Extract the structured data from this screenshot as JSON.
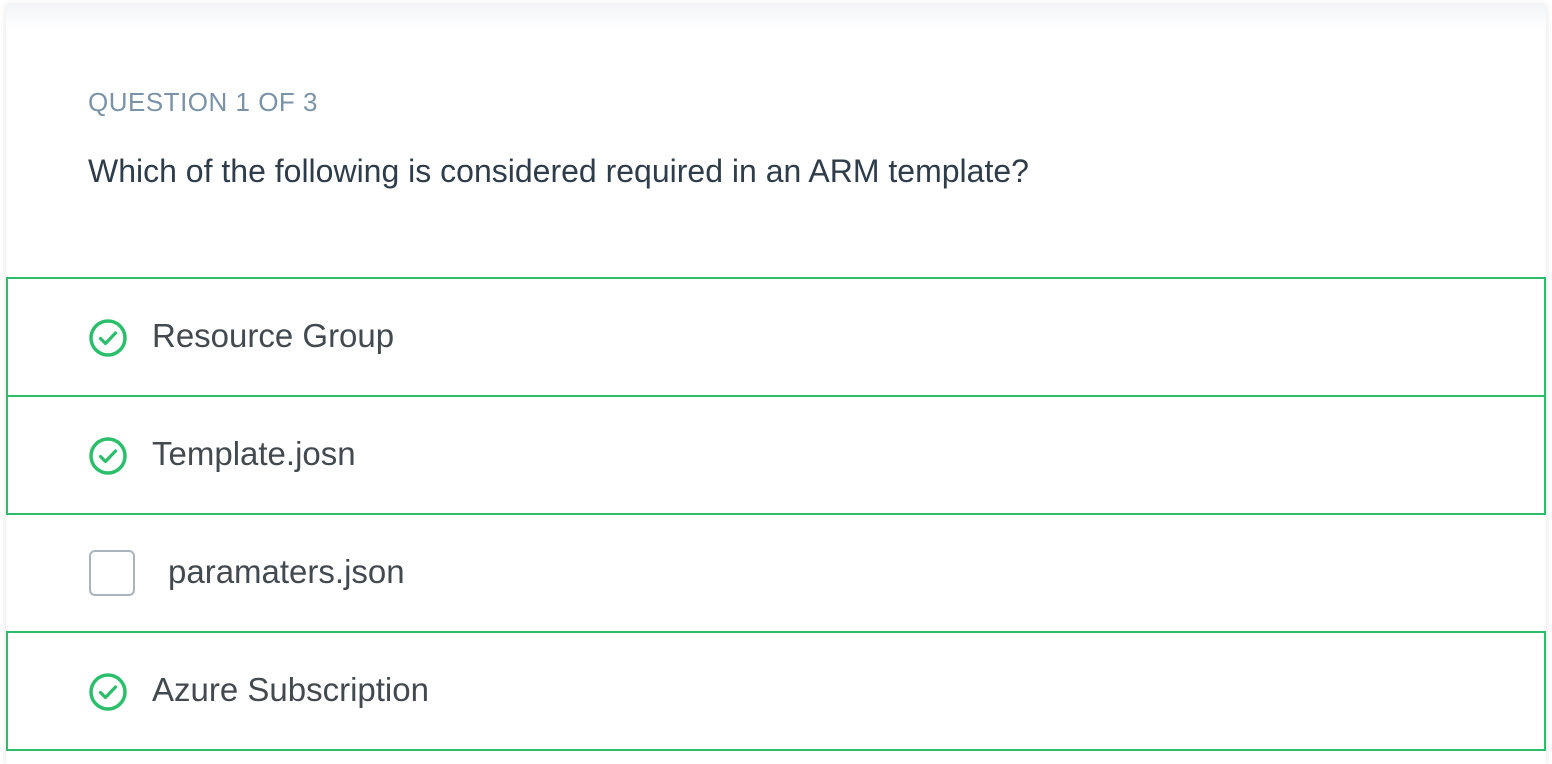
{
  "question": {
    "counter": "QUESTION 1 OF 3",
    "text": "Which of the following is considered required in an ARM template?"
  },
  "options": [
    {
      "label": "Resource Group",
      "selected": true,
      "icon": "check-circle-icon"
    },
    {
      "label": "Template.josn",
      "selected": true,
      "icon": "check-circle-icon"
    },
    {
      "label": "paramaters.json",
      "selected": false,
      "icon": "empty-checkbox"
    },
    {
      "label": "Azure Subscription",
      "selected": true,
      "icon": "check-circle-icon"
    }
  ],
  "colors": {
    "accent_green": "#2bbf6c",
    "counter_text": "#7a93a8",
    "question_text": "#2e3d49",
    "option_text": "#424a50",
    "checkbox_border": "#a9b4bd"
  }
}
